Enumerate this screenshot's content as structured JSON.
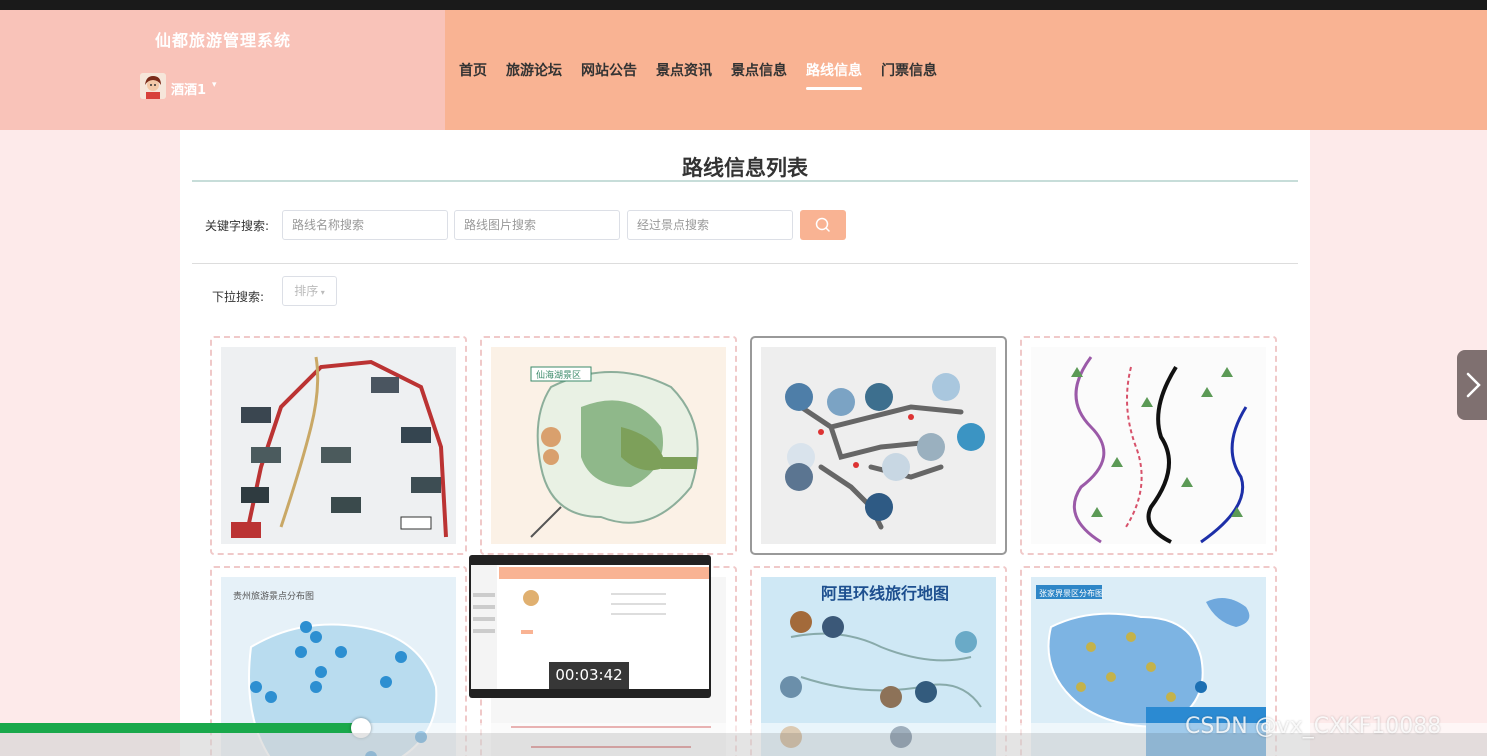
{
  "site": {
    "title": "仙都旅游管理系统",
    "user_name": "酒酒1",
    "user_caret": "▾"
  },
  "nav": {
    "items": [
      "首页",
      "旅游论坛",
      "网站公告",
      "景点资讯",
      "景点信息",
      "路线信息",
      "门票信息"
    ],
    "active": "路线信息"
  },
  "page": {
    "title": "路线信息列表",
    "search_label": "关键字搜索:",
    "search_fields": [
      {
        "placeholder": "路线名称搜索"
      },
      {
        "placeholder": "路线图片搜索"
      },
      {
        "placeholder": "经过景点搜索"
      }
    ],
    "dropdown_label": "下拉搜索:",
    "dropdown_value": "排序"
  },
  "cards": [
    {
      "name": "route-map-1",
      "text": ""
    },
    {
      "name": "route-map-2",
      "text": "仙海湖景区"
    },
    {
      "name": "route-map-3",
      "text": ""
    },
    {
      "name": "route-map-4",
      "text": ""
    },
    {
      "name": "route-map-5",
      "text": "贵州旅游景点分布图"
    },
    {
      "name": "route-map-6",
      "text": ""
    },
    {
      "name": "route-map-7",
      "text": "阿里环线旅行地图"
    },
    {
      "name": "route-map-8",
      "text": "张家界景区分布图"
    }
  ],
  "video": {
    "time": "00:03:42",
    "progress_fraction": 0.245
  },
  "watermark": "CSDN @vx_CXKF10088",
  "colors": {
    "header_left": "#f9c3b9",
    "header_right": "#f9b393",
    "accent": "#f9b393",
    "progress": "#19a84b"
  }
}
